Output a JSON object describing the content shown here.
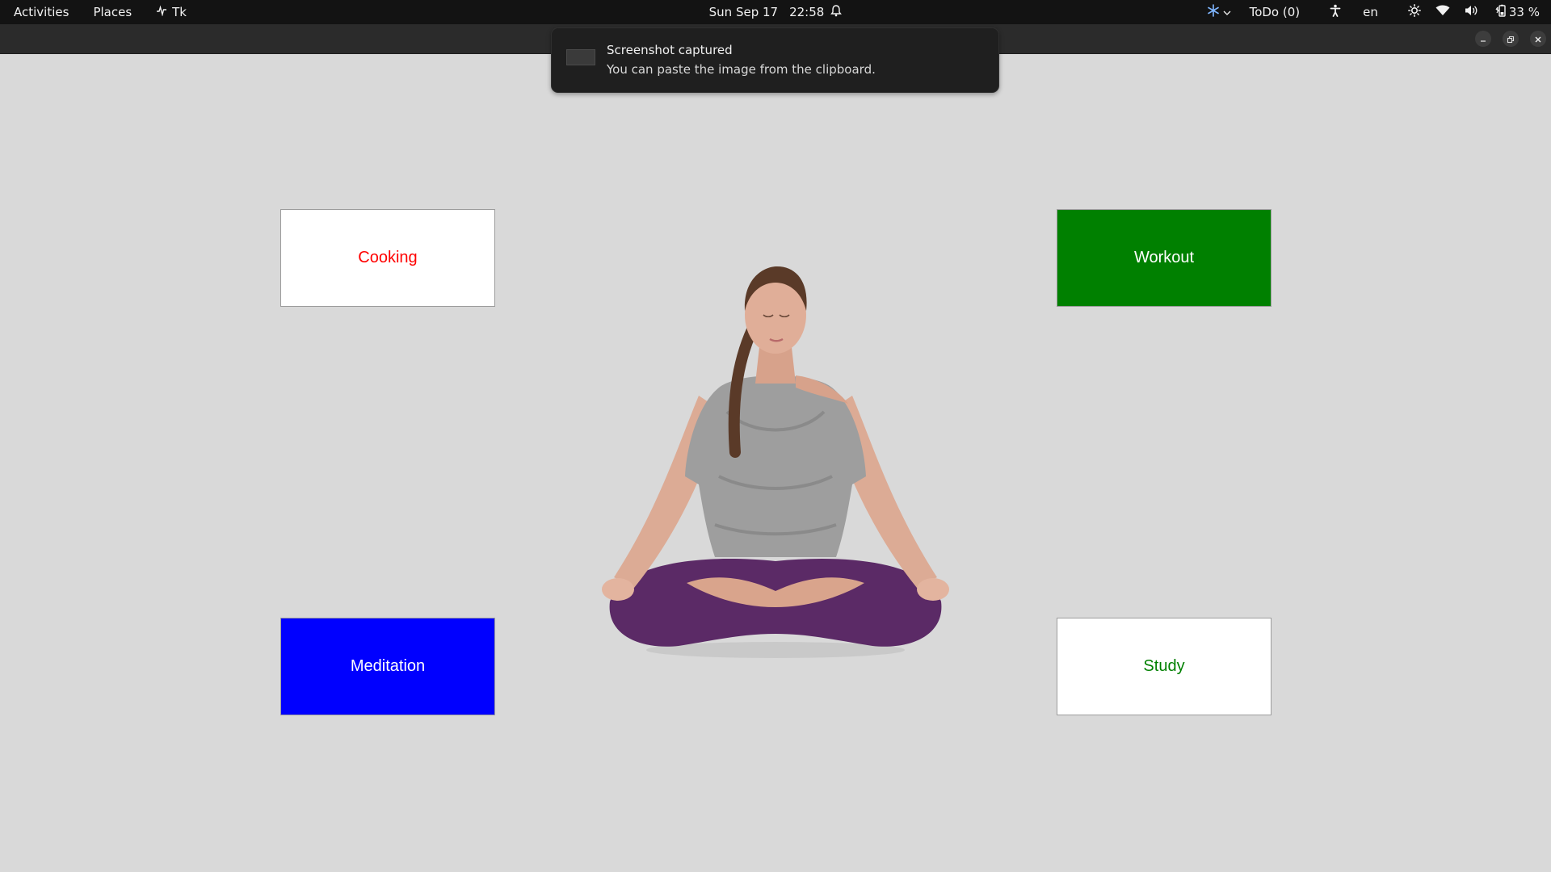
{
  "topbar": {
    "activities": "Activities",
    "places": "Places",
    "app_name": "Tk",
    "date": "Sun Sep 17",
    "time": "22:58",
    "todo": "ToDo (0)",
    "language": "en",
    "battery": "33 %"
  },
  "notification": {
    "title": "Screenshot captured",
    "body": "You can paste the image from the clipboard."
  },
  "tiles": {
    "cooking": "Cooking",
    "workout": "Workout",
    "meditation": "Meditation",
    "study": "Study"
  },
  "colors": {
    "background": "#d9d9d9",
    "cooking_text": "#ff0000",
    "workout_bg": "#008000",
    "meditation_bg": "#0000ff",
    "study_text": "#008000"
  },
  "icons": {
    "app": "tk-app-icon",
    "alarm": "alarm-icon",
    "weather": "snowflake-icon",
    "accessibility": "accessibility-icon",
    "brightness": "brightness-icon",
    "wifi": "wifi-icon",
    "volume": "volume-icon",
    "battery": "battery-icon"
  }
}
